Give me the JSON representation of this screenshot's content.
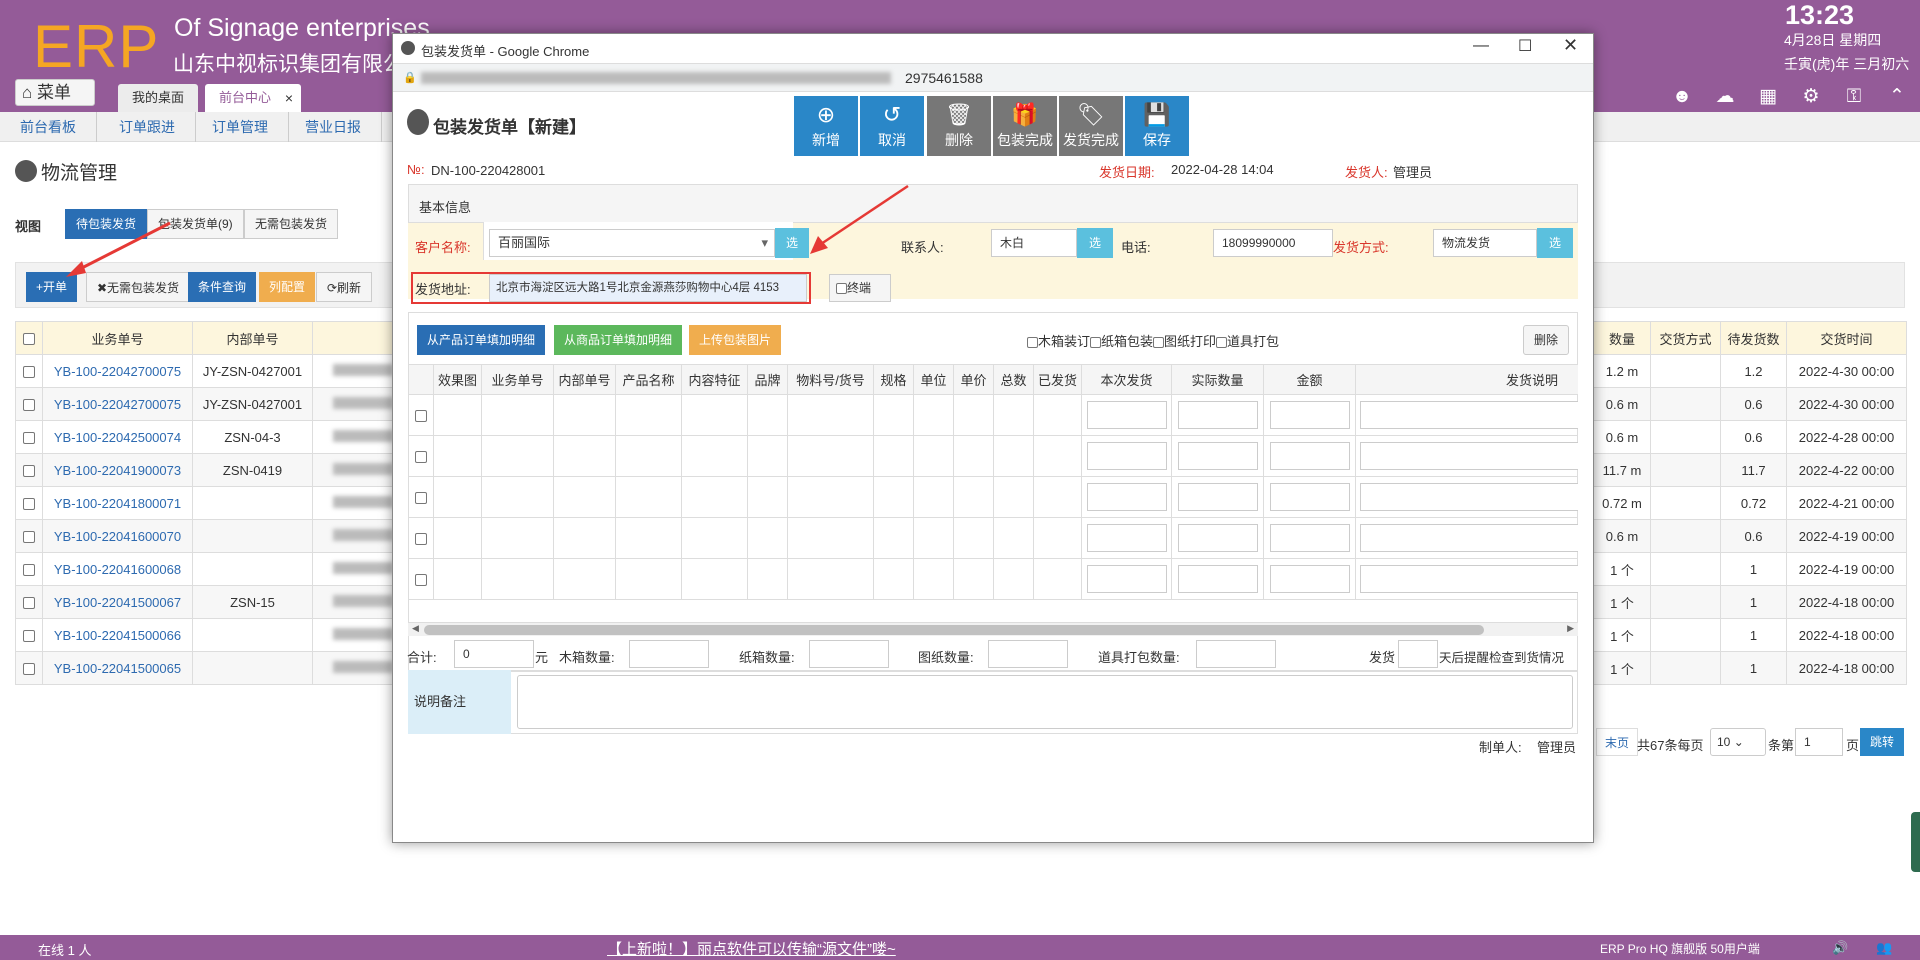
{
  "header": {
    "logo": "ERP",
    "company_en": "Of Signage enterprises",
    "company_cn": "山东中视标识集团有限公",
    "time": "13:23",
    "date": "4月28日 星期四",
    "lunar": "壬寅(虎)年 三月初六",
    "menu_label": "菜单",
    "tabs": [
      {
        "label": "我的桌面"
      },
      {
        "label": "前台中心",
        "close": "×"
      }
    ],
    "icons": [
      "user-icon",
      "cloud-icon",
      "grid-icon",
      "gear-icon",
      "key-icon",
      "collapse-icon"
    ]
  },
  "nav": {
    "items": [
      "前台看板",
      "订单跟进",
      "订单管理",
      "营业日报"
    ]
  },
  "page": {
    "title": "物流管理",
    "view_label": "视图",
    "view_tabs": [
      {
        "label": "待包装发货"
      },
      {
        "label": "包装发货单(9)"
      },
      {
        "label": "无需包装发货"
      }
    ],
    "toolbar": {
      "open": "+开单",
      "noneed": "✖无需包装发货",
      "query": "条件查询",
      "cols": "列配置",
      "refresh": "⟳刷新"
    },
    "left_headers": [
      "业务单号",
      "内部单号"
    ],
    "left_rows": [
      [
        "YB-100-22042700075",
        "JY-ZSN-0427001"
      ],
      [
        "YB-100-22042700075",
        "JY-ZSN-0427001"
      ],
      [
        "YB-100-22042500074",
        "ZSN-04-3"
      ],
      [
        "YB-100-22041900073",
        "ZSN-0419"
      ],
      [
        "YB-100-22041800071",
        ""
      ],
      [
        "YB-100-22041600070",
        ""
      ],
      [
        "YB-100-22041600068",
        ""
      ],
      [
        "YB-100-22041500067",
        "ZSN-15"
      ],
      [
        "YB-100-22041500066",
        ""
      ],
      [
        "YB-100-22041500065",
        ""
      ]
    ],
    "right_headers": [
      "数量",
      "交货方式",
      "待发货数",
      "交货时间"
    ],
    "right_rows": [
      [
        "1.2 m",
        "",
        "1.2",
        "2022-4-30 00:00"
      ],
      [
        "0.6 m",
        "",
        "0.6",
        "2022-4-30 00:00"
      ],
      [
        "0.6 m",
        "",
        "0.6",
        "2022-4-28 00:00"
      ],
      [
        "11.7 m",
        "",
        "11.7",
        "2022-4-22 00:00"
      ],
      [
        "0.72 m",
        "",
        "0.72",
        "2022-4-21 00:00"
      ],
      [
        "0.6 m",
        "",
        "0.6",
        "2022-4-19 00:00"
      ],
      [
        "1 个",
        "",
        "1",
        "2022-4-19 00:00"
      ],
      [
        "1 个",
        "",
        "1",
        "2022-4-18 00:00"
      ],
      [
        "1 个",
        "",
        "1",
        "2022-4-18 00:00"
      ],
      [
        "1 个",
        "",
        "1",
        "2022-4-18 00:00"
      ]
    ],
    "pager": {
      "last": "末页",
      "total": "共67条每页",
      "per_page": "10",
      "suffix": "条第",
      "page": "1",
      "page_suffix": "页",
      "jump": "跳转"
    }
  },
  "status": {
    "online": "在线  1  人",
    "notice": "【上新啦！】丽点软件可以传输“源文件”喽~",
    "version": "ERP Pro HQ 旗舰版 50用户端"
  },
  "popup": {
    "window_title": "包装发货单 - Google Chrome",
    "url_tail": "2975461588",
    "form_title": "包装发货单【新建】",
    "buttons": [
      {
        "label": "新增",
        "glyph": "⊕"
      },
      {
        "label": "取消",
        "glyph": "↺"
      },
      {
        "label": "删除",
        "glyph": "🗑"
      },
      {
        "label": "包装完成",
        "glyph": "🎁"
      },
      {
        "label": "发货完成",
        "glyph": "🏷"
      },
      {
        "label": "保存",
        "glyph": "💾"
      }
    ],
    "no_label": "№:",
    "no_value": "DN-100-220428001",
    "ship_date_label": "发货日期:",
    "ship_date": "2022-04-28 14:04",
    "shipper_label": "发货人:",
    "shipper": "管理员",
    "section_base": "基本信息",
    "customer_label": "客户名称:",
    "customer": "百丽国际",
    "select_label": "选",
    "contact_label": "联系人:",
    "contact": "木白",
    "phone_label": "电话:",
    "phone": "18099990000",
    "method_label": "发货方式:",
    "method": "物流发货",
    "address_label": "发货地址:",
    "address": "北京市海淀区远大路1号北京金源燕莎购物中心4层 4153",
    "terminal_label": "终端",
    "btn_from_product": "从产品订单填加明细",
    "btn_from_goods": "从商品订单填加明细",
    "btn_upload": "上传包装图片",
    "options": [
      "木箱装订",
      "纸箱包装",
      "图纸打印",
      "道具打包"
    ],
    "delete_label": "删除",
    "detail_headers": [
      "效果图",
      "业务单号",
      "内部单号",
      "产品名称",
      "内容特征",
      "品牌",
      "物料号/货号",
      "规格",
      "单位",
      "单价",
      "总数",
      "已发货",
      "本次发货",
      "实际数量",
      "金额",
      "发货说明"
    ],
    "total_label": "合计:",
    "total_value": "0",
    "yuan": "元",
    "wood_label": "木箱数量:",
    "carton_label": "纸箱数量:",
    "drawing_label": "图纸数量:",
    "props_label": "道具打包数量:",
    "remind_pre": "发货",
    "remind_post": "天后提醒检查到货情况",
    "remark_label": "说明备注",
    "maker_label": "制单人:",
    "maker": "管理员"
  }
}
